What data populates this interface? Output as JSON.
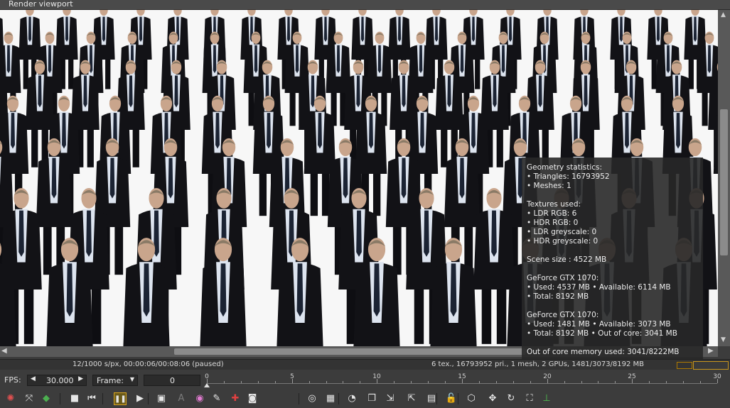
{
  "window": {
    "title": "Render viewport"
  },
  "stats_overlay": {
    "lines": [
      "Geometry statistics:",
      " • Triangles: 16793952",
      " • Meshes: 1",
      "",
      "Textures used:",
      " • LDR RGB: 6",
      " • HDR RGB: 0",
      " • LDR greyscale: 0",
      " • HDR greyscale: 0",
      "",
      "Scene size : 4522 MB",
      "",
      " GeForce GTX 1070:",
      " • Used: 4537 MB • Available: 6114 MB",
      " • Total: 8192 MB",
      "",
      " GeForce GTX 1070:",
      " • Used: 1481 MB • Available: 3073 MB",
      " • Total: 8192 MB • Out of core: 3041 MB",
      "",
      "Out of core memory used: 3041/8222MB"
    ]
  },
  "status_bar": {
    "left": "12/1000 s/px, 00:00:06/00:08:06 (paused)",
    "right": "6 tex., 16793952 pri., 1 mesh, 2 GPUs, 1481/3073/8192 MB"
  },
  "timeline": {
    "fps_label": "FPS:",
    "fps_value": "30.000",
    "frame_mode": "Frame:",
    "frame_value": "0",
    "ruler_labels": [
      "0",
      "5",
      "10",
      "15",
      "20",
      "25",
      "30"
    ]
  },
  "toolbar": {
    "icons": [
      "render-target-icon",
      "resolution-icon",
      "cube-color-icon",
      "stop-icon",
      "rewind-icon",
      "pause-icon",
      "play-icon",
      "screenshot-icon",
      "afi-icon",
      "color-wheel-icon",
      "paint-icon",
      "red-pick-icon",
      "mask-icon",
      "picker-icon",
      "checker-icon",
      "gauge-icon",
      "copy-icon",
      "export-icon",
      "import-icon",
      "render-pass-icon",
      "lock-icon",
      "box-icon",
      "move-icon",
      "rotate-icon",
      "fit-icon",
      "axes-icon"
    ]
  },
  "colors": {
    "panel": "#3c3c3c",
    "accent": "#d9a520",
    "overlay": "#282828"
  }
}
